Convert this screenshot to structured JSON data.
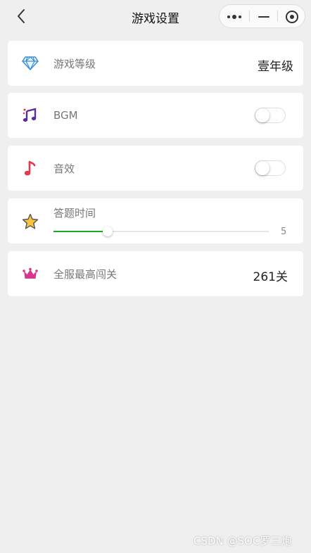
{
  "header": {
    "title": "游戏设置"
  },
  "settings": [
    {
      "label": "游戏等级",
      "value": "壹年级",
      "icon": "diamond-icon"
    },
    {
      "label": "BGM",
      "control": "switch",
      "on": false,
      "icon": "music-notes-icon"
    },
    {
      "label": "音效",
      "control": "switch",
      "on": false,
      "icon": "music-note-icon"
    },
    {
      "label": "答题时间",
      "control": "slider",
      "value": "5",
      "min": 0,
      "max": 20,
      "icon": "star-icon"
    },
    {
      "label": "全服最高闯关",
      "value": "261关",
      "icon": "crown-icon"
    }
  ],
  "watermark": "CSDN @SOC罗三炮",
  "colors": {
    "accent": "#1aad19",
    "background": "#efefef"
  }
}
